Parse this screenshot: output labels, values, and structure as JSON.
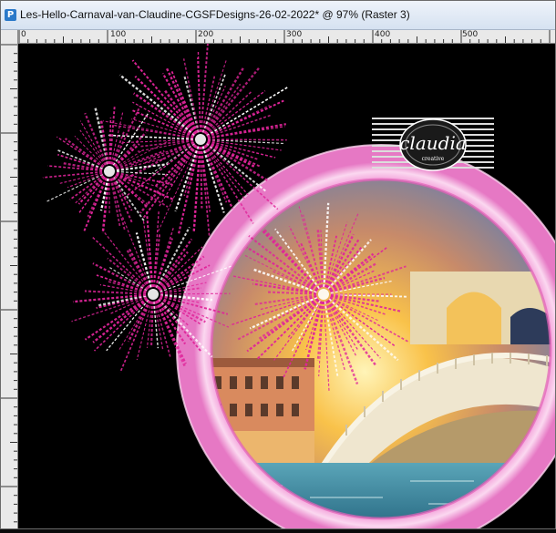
{
  "window": {
    "title": "Les-Hello-Carnaval-van-Claudine-CGSFDesigns-26-02-2022* @  97% (Raster 3)"
  },
  "ruler": {
    "labels": [
      "0",
      "100",
      "200",
      "300",
      "400",
      "500"
    ]
  },
  "canvas": {
    "background_color": "#000000",
    "ring_color": "#f4a9d9",
    "firework_color": "#e0259a",
    "watermark": {
      "name": "claudia",
      "tagline": "creative"
    }
  },
  "icons": {
    "app": "psp-app-icon"
  }
}
